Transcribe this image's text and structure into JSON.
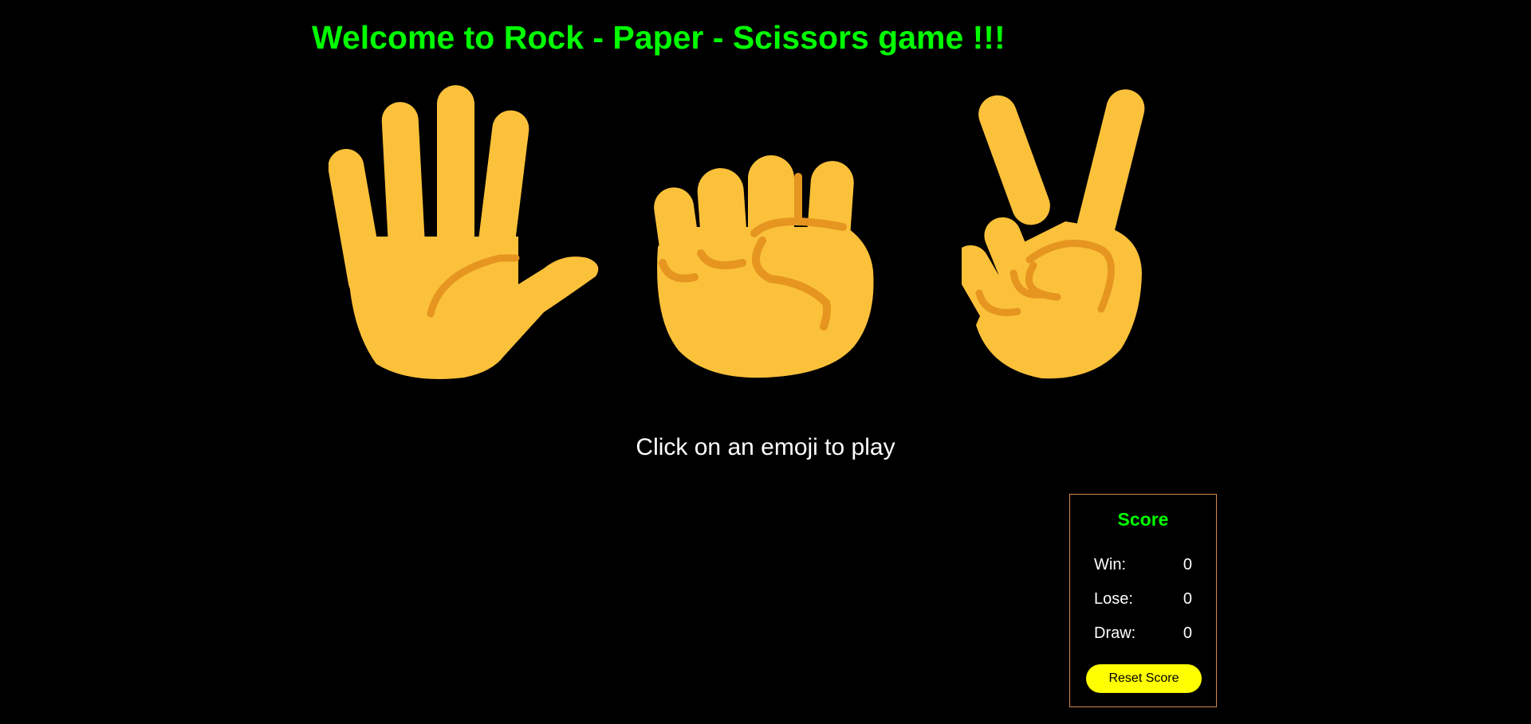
{
  "header": {
    "title": "Welcome to Rock - Paper - Scissors game !!!"
  },
  "choices": [
    {
      "id": "paper",
      "icon": "raised-hand-icon"
    },
    {
      "id": "rock",
      "icon": "raised-fist-icon"
    },
    {
      "id": "scissors",
      "icon": "victory-hand-icon"
    }
  ],
  "instructions": "Click on an emoji to play",
  "score": {
    "title": "Score",
    "win_label": "Win:",
    "win_value": "0",
    "lose_label": "Lose:",
    "lose_value": "0",
    "draw_label": "Draw:",
    "draw_value": "0",
    "reset_label": "Reset Score"
  },
  "colors": {
    "background": "#000000",
    "title": "#00ff00",
    "emoji_skin": "#fbc13a",
    "emoji_crease": "#e59520",
    "score_border": "#d2884a",
    "reset_button": "#ffff00"
  }
}
